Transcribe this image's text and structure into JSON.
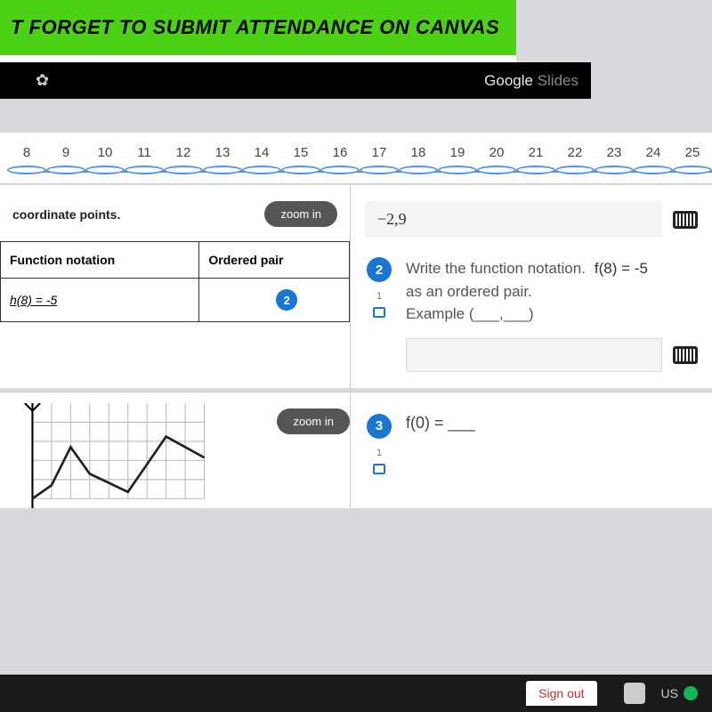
{
  "banner": {
    "text": "T FORGET TO SUBMIT ATTENDANCE ON CANVAS"
  },
  "slidebar": {
    "brand_a": "Google",
    "brand_b": " Slides"
  },
  "ruler": {
    "ticks": [
      "8",
      "9",
      "10",
      "11",
      "12",
      "13",
      "14",
      "15",
      "16",
      "17",
      "18",
      "19",
      "20",
      "21",
      "22",
      "23",
      "24",
      "25"
    ]
  },
  "left1": {
    "heading": "coordinate points.",
    "zoom": "zoom in",
    "col1": "Function notation",
    "col2": "Ordered pair",
    "row1_a": "h(8) = -5",
    "row1_badge": "2"
  },
  "right1": {
    "prev_answer": "−2,9",
    "q_num": "2",
    "q_sub": "1",
    "line1": "Write the function notation.",
    "fn": "f(8) = -5",
    "line2": "as an ordered pair.",
    "line3": "Example (___,___)"
  },
  "left2": {
    "zoom": "zoom in"
  },
  "right2": {
    "q_num": "3",
    "q_sub": "1",
    "text": "f(0) = ___"
  },
  "chart_data": {
    "type": "line",
    "title": "",
    "xlabel": "",
    "ylabel": "",
    "xlim": [
      0,
      10
    ],
    "ylim": [
      0,
      8
    ],
    "series": [
      {
        "name": "f",
        "x": [
          0,
          1,
          2,
          3,
          5,
          7,
          9
        ],
        "y": [
          0,
          1.2,
          4.5,
          2.2,
          0.6,
          5.4,
          3.6
        ]
      }
    ]
  },
  "footer": {
    "signout": "Sign out",
    "us": "US"
  }
}
